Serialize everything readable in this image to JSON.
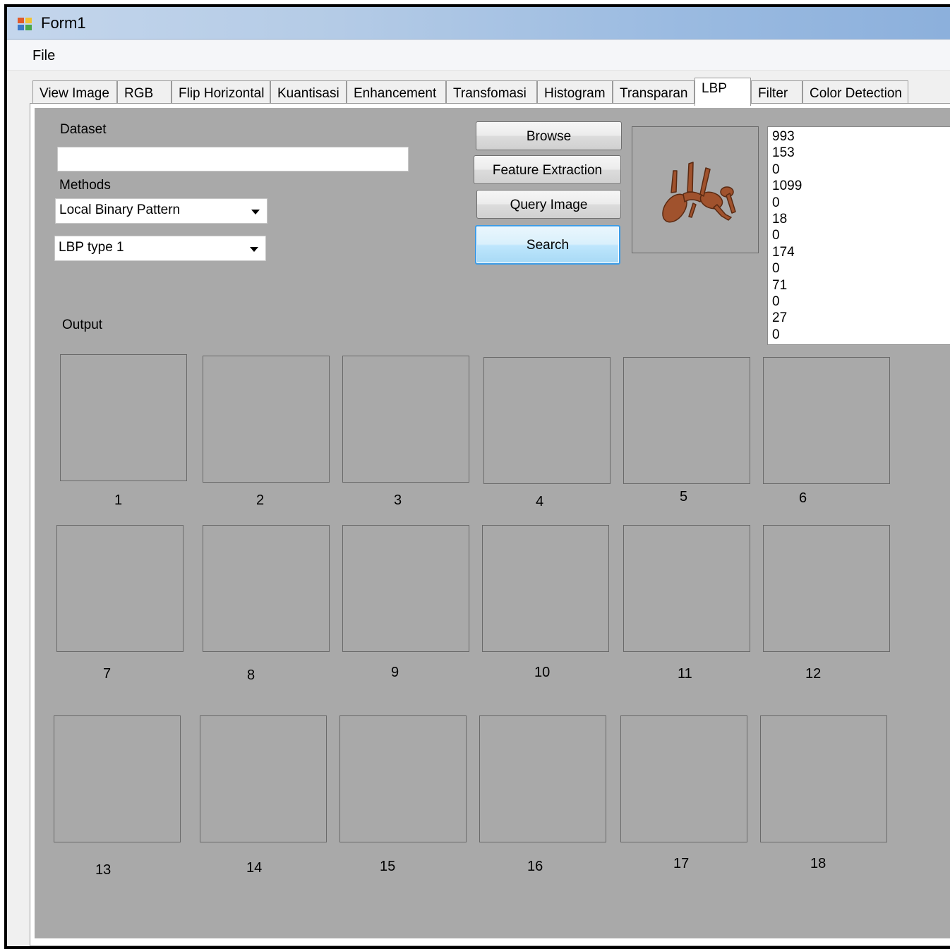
{
  "window": {
    "title": "Form1"
  },
  "menu": {
    "file": "File"
  },
  "tabs": [
    "View Image",
    "RGB",
    "Flip Horizontal",
    "Kuantisasi",
    "Enhancement",
    "Transfomasi",
    "Histogram",
    "Transparan",
    "LBP",
    "Filter",
    "Color Detection"
  ],
  "active_tab": "LBP",
  "form": {
    "dataset_label": "Dataset",
    "dataset_value": "",
    "methods_label": "Methods",
    "method_selected": "Local Binary Pattern",
    "lbp_type_selected": "LBP type 1",
    "output_label": "Output"
  },
  "buttons": {
    "browse": "Browse",
    "feature_extraction": "Feature Extraction",
    "query_image": "Query Image",
    "search": "Search"
  },
  "feature_values": [
    "993",
    "153",
    "0",
    "1099",
    "0",
    "18",
    "0",
    "174",
    "0",
    "71",
    "0",
    "27",
    "0"
  ],
  "results": [
    "1",
    "2",
    "3",
    "4",
    "5",
    "6",
    "7",
    "8",
    "9",
    "10",
    "11",
    "12",
    "13",
    "14",
    "15",
    "16",
    "17",
    "18"
  ],
  "colors": {
    "panel": "#a9a9a9",
    "titlebar": "#9bbbe1",
    "focus": "#3c9ce6",
    "ant": "#a0522d"
  }
}
